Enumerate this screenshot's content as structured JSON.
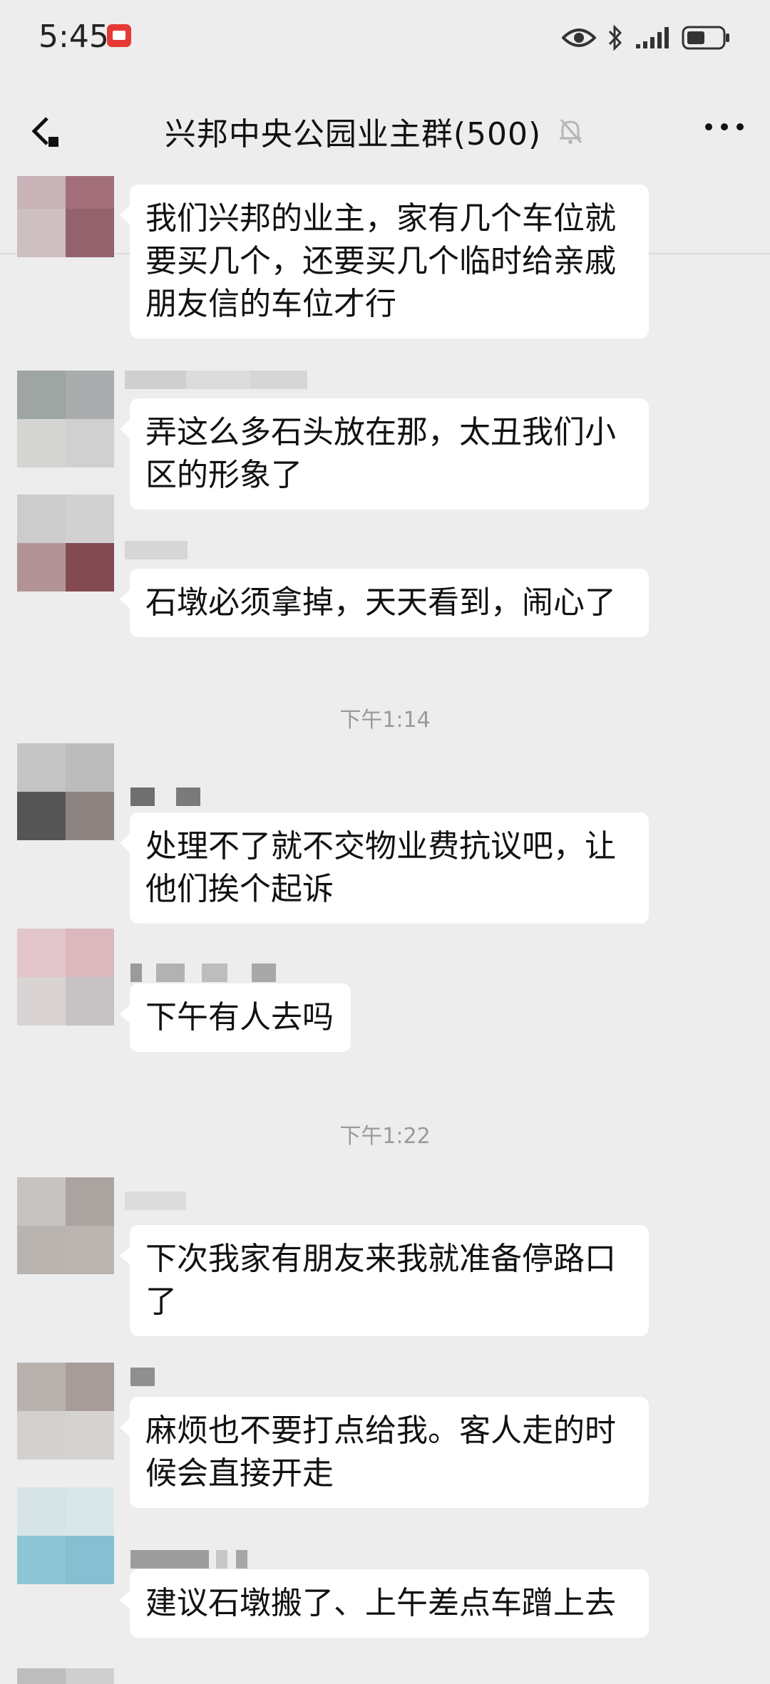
{
  "status_bar": {
    "time": "5:45",
    "icons": [
      "notification-icon",
      "eye-icon",
      "bluetooth-icon",
      "signal-icon",
      "battery-icon"
    ]
  },
  "nav": {
    "title": "兴邦中央公园业主群(500)",
    "icons": [
      "back-arrow-icon",
      "mute-bell-icon",
      "more-icon"
    ]
  },
  "messages": [
    {
      "text_lines": [
        "我们兴邦的业主，家有几个车位就",
        "要买几个，还要买几个临时给亲戚",
        "朋友信的车位才行"
      ]
    },
    {
      "text_lines": [
        "弄这么多石头放在那，太丑我们小",
        "区的形象了"
      ]
    },
    {
      "text_lines": [
        "石墩必须拿掉，天天看到，闹心了"
      ]
    },
    {
      "text_lines": [
        "处理不了就不交物业费抗议吧，让",
        "他们挨个起诉"
      ]
    },
    {
      "text_lines": [
        "下午有人去吗"
      ]
    },
    {
      "text_lines": [
        "下次我家有朋友来我就准备停路口",
        "了"
      ]
    },
    {
      "text_lines": [
        "麻烦也不要打点给我。客人走的时",
        "候会直接开走"
      ]
    },
    {
      "text_lines": [
        "建议石墩搬了、上午差点车蹭上去"
      ]
    }
  ],
  "time_dividers": [
    "下午1:14",
    "下午1:22"
  ],
  "colors": {
    "background": "#ededed",
    "bubble": "#ffffff",
    "timestamp": "#9a9a9a"
  }
}
